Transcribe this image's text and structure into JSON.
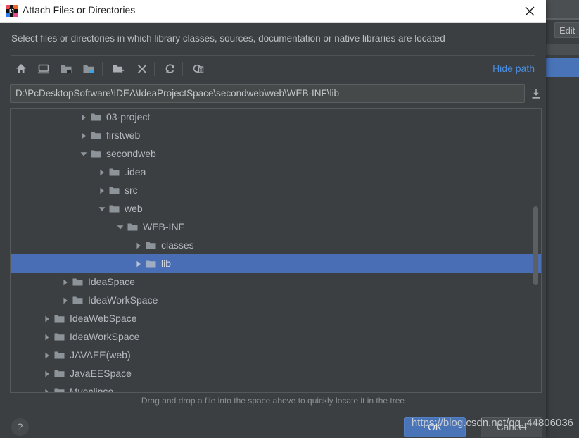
{
  "ide_background": {
    "edit_button_label": "Edit"
  },
  "dialog": {
    "title": "Attach Files or Directories",
    "app_icon": "intellij-idea-logo-icon",
    "close_icon": "close-icon",
    "description": "Select files or directories in which library classes, sources, documentation or native libraries are located",
    "toolbar": {
      "buttons": [
        {
          "name": "home-icon",
          "tooltip": "Home"
        },
        {
          "name": "desktop-icon",
          "tooltip": "Desktop"
        },
        {
          "name": "folder-project-icon",
          "tooltip": "Project Directory"
        },
        {
          "name": "folder-module-icon",
          "tooltip": "Module Directory"
        },
        {
          "name": "new-folder-icon",
          "tooltip": "New Folder"
        },
        {
          "name": "delete-icon",
          "tooltip": "Delete"
        },
        {
          "name": "refresh-icon",
          "tooltip": "Refresh"
        },
        {
          "name": "show-hidden-icon",
          "tooltip": "Show Hidden Files"
        }
      ],
      "hide_path_label": "Hide path"
    },
    "path_field": {
      "value": "D:\\PcDesktopSoftware\\IDEA\\IdeaProjectSpace\\secondweb\\web\\WEB-INF\\lib",
      "placeholder": "",
      "dropdown_icon": "collapse-down-icon"
    },
    "tree": {
      "items": [
        {
          "label": "03-project",
          "depth": 3,
          "state": "collapsed",
          "selected": false
        },
        {
          "label": "firstweb",
          "depth": 3,
          "state": "collapsed",
          "selected": false
        },
        {
          "label": "secondweb",
          "depth": 3,
          "state": "expanded",
          "selected": false
        },
        {
          "label": ".idea",
          "depth": 4,
          "state": "collapsed",
          "selected": false
        },
        {
          "label": "src",
          "depth": 4,
          "state": "collapsed",
          "selected": false
        },
        {
          "label": "web",
          "depth": 4,
          "state": "expanded",
          "selected": false
        },
        {
          "label": "WEB-INF",
          "depth": 5,
          "state": "expanded",
          "selected": false
        },
        {
          "label": "classes",
          "depth": 6,
          "state": "collapsed",
          "selected": false
        },
        {
          "label": "lib",
          "depth": 6,
          "state": "collapsed",
          "selected": true
        },
        {
          "label": "IdeaSpace",
          "depth": 2,
          "state": "collapsed",
          "selected": false
        },
        {
          "label": "IdeaWorkSpace",
          "depth": 2,
          "state": "collapsed",
          "selected": false
        },
        {
          "label": "IdeaWebSpace",
          "depth": 1,
          "state": "collapsed",
          "selected": false
        },
        {
          "label": "IdeaWorkSpace",
          "depth": 1,
          "state": "collapsed",
          "selected": false
        },
        {
          "label": "JAVAEE(web)",
          "depth": 1,
          "state": "collapsed",
          "selected": false
        },
        {
          "label": "JavaEESpace",
          "depth": 1,
          "state": "collapsed",
          "selected": false
        },
        {
          "label": "Myeclipse",
          "depth": 1,
          "state": "collapsed",
          "selected": false
        }
      ]
    },
    "drag_hint": "Drag and drop a file into the space above to quickly locate it in the tree",
    "footer": {
      "help_label": "?",
      "ok_label": "OK",
      "cancel_label": "Cancel"
    }
  },
  "watermark": {
    "text": "https://blog.csdn.net/qq_44806036"
  },
  "colors": {
    "dialog_bg": "#3c3f41",
    "titlebar_bg": "#ffffff",
    "selection_blue": "#4a6eb5",
    "ok_button_blue": "#4a74b8",
    "link_blue": "#4b8ee0",
    "text_primary": "#b6bac0",
    "folder_icon": "#8d9499"
  }
}
